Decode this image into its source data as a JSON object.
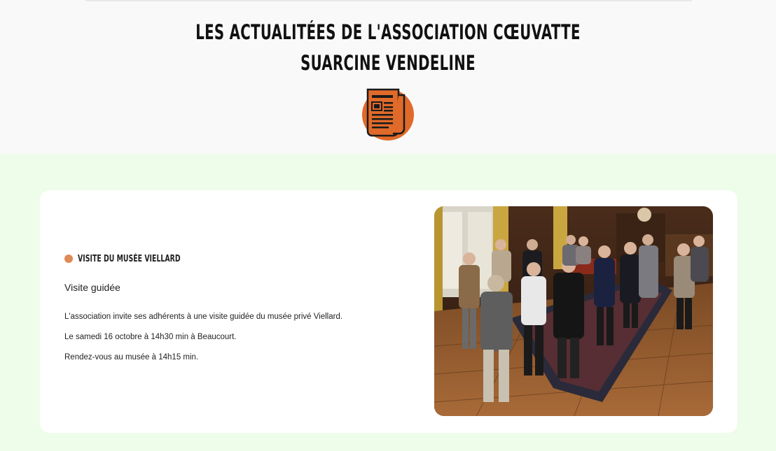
{
  "header": {
    "title_line1": "LES ACTUALITÉES DE L'ASSOCIATION CŒUVATTE",
    "title_line2": "SUARCINE VENDELINE",
    "icon": "newspaper-icon",
    "icon_color": "#e06a2a"
  },
  "event": {
    "title": "VISITE DU MUSÉE VIELLARD",
    "subtitle": "Visite guidée",
    "description": [
      "L'association invite ses adhérents à une visite guidée du musée privé Viellard.",
      "Le samedi 16 octobre à 14h30 min à Beaucourt.",
      "Rendez-vous au musée à 14h15 min."
    ],
    "image_subject": "group-visit-museum-photo"
  },
  "colors": {
    "section_background": "#eefcea",
    "bullet": "#e08a55",
    "card": "#ffffff"
  }
}
